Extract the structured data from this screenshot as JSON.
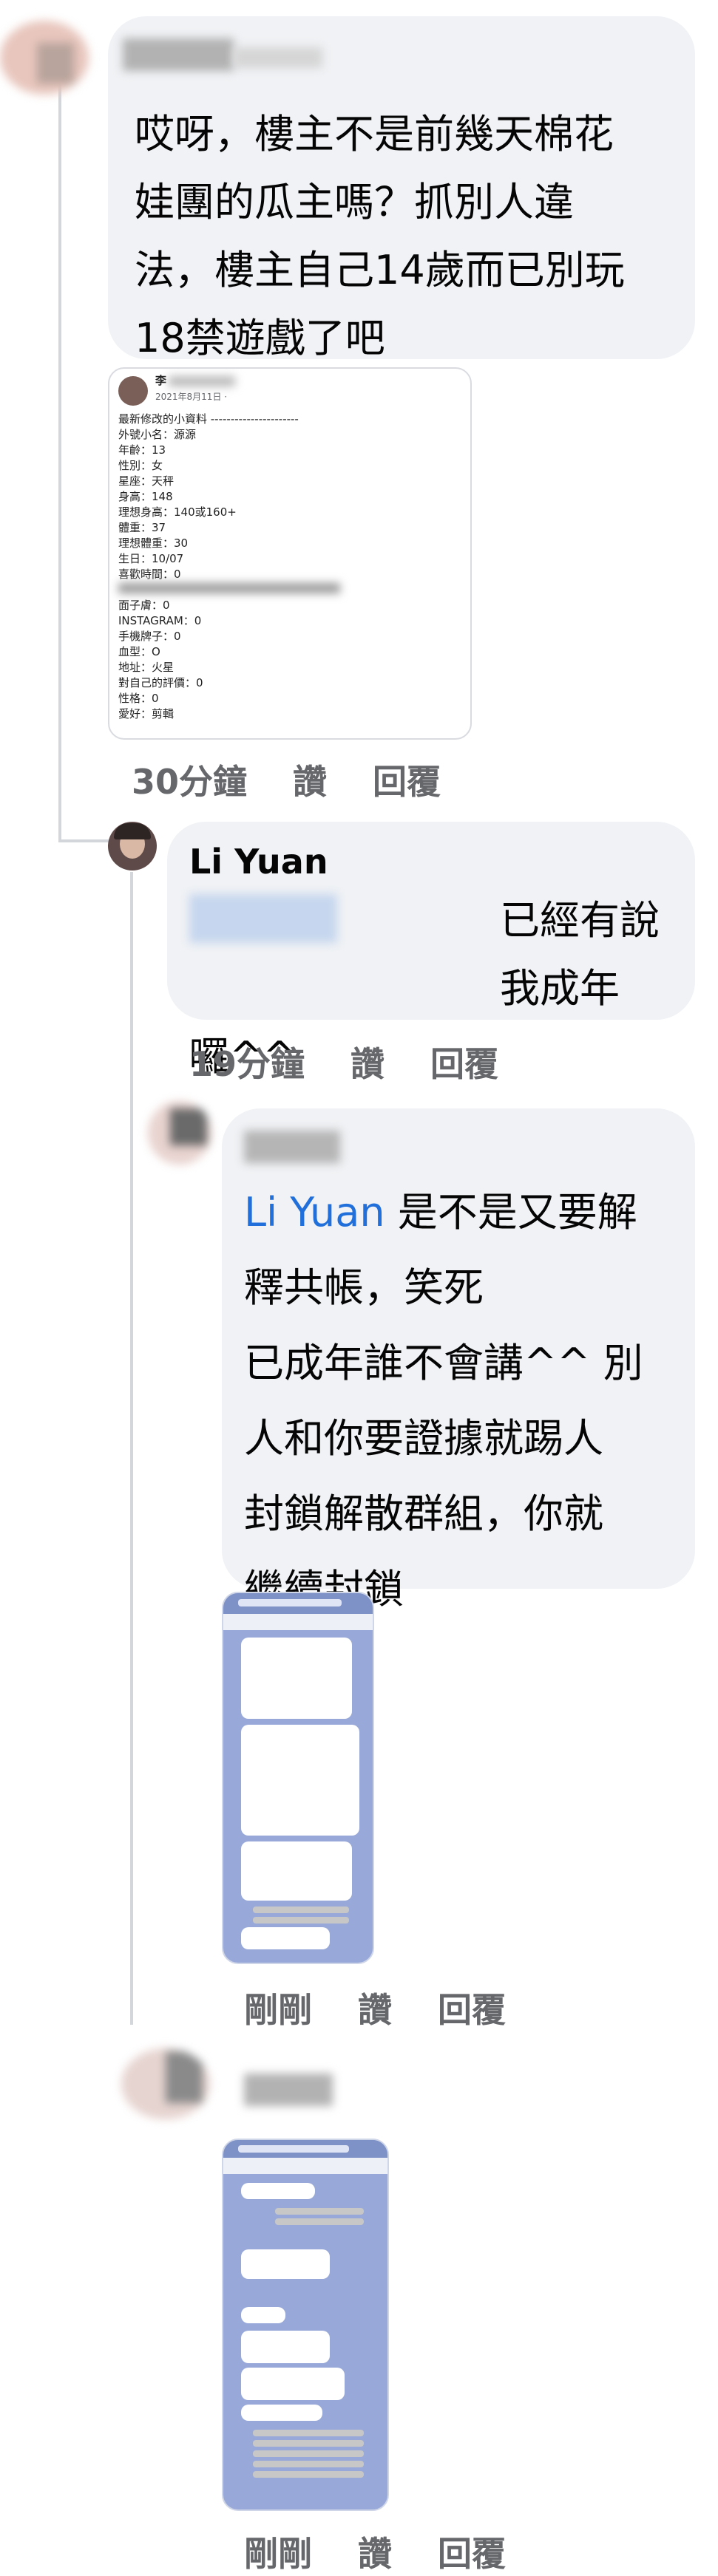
{
  "comments": [
    {
      "text": "哎呀，樓主不是前幾天棉花娃團的瓜主嗎？抓別人違法，樓主自己14歲而已別玩18禁遊戲了吧",
      "lines": [
        "哎呀，樓主不是前幾天棉花",
        "娃團的瓜主嗎？抓別人違",
        "法，樓主自己14歲而已別玩",
        "18禁遊戲了吧"
      ],
      "attachment": {
        "post_name": "李",
        "post_date": "2021年8月11日 · ",
        "lines": [
          "最新修改的小資料 ----------------------",
          "外號小名：源源",
          "年齡：13",
          "性別：女",
          "星座：天秤",
          "身高：148",
          "理想身高：140或160+",
          "體重：37",
          "理想體重：30",
          "生日：10/07",
          "喜歡時間：0",
          "",
          "面子膚：0",
          "INSTAGRAM：0",
          "手機牌子：0",
          "血型：O",
          "地址：火星",
          "對自己的評價：0",
          "性格：0",
          "愛好：剪輯"
        ]
      },
      "time": "30分鐘",
      "like": "讚",
      "reply": "回覆"
    },
    {
      "name": "Li Yuan",
      "lines": [
        "已經有說我成年",
        "囉^^"
      ],
      "time": "19分鐘",
      "like": "讚",
      "reply": "回覆"
    },
    {
      "mention": "Li Yuan",
      "lines": [
        " 是不是又要解",
        "釋共帳，笑死",
        "已成年誰不會講^^ 別",
        "人和你要證據就踢人",
        "封鎖解散群組，你就",
        "繼續封鎖"
      ],
      "time": "剛剛",
      "like": "讚",
      "reply": "回覆"
    },
    {
      "time": "剛剛",
      "like": "讚",
      "reply": "回覆"
    }
  ]
}
